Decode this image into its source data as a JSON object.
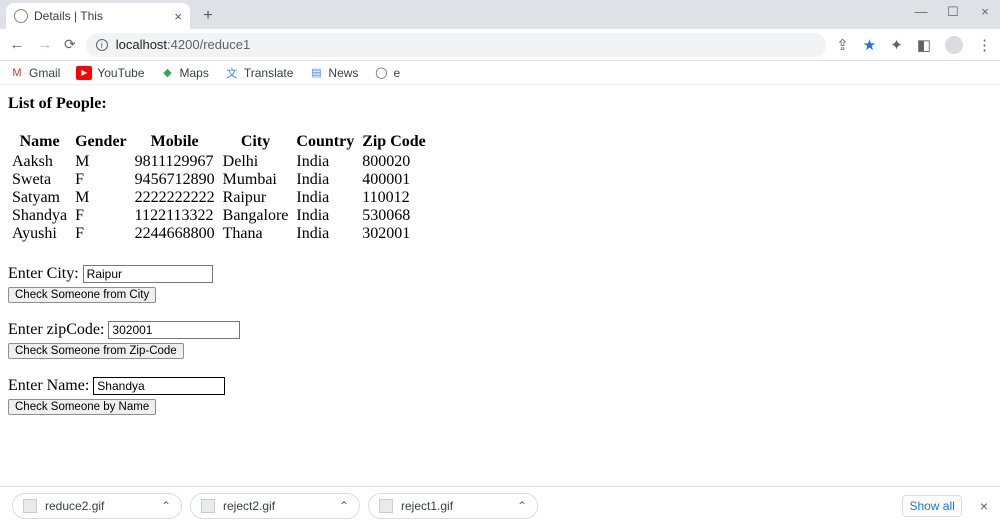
{
  "window": {
    "tab_title": "Details | This",
    "url_display": "localhost:4200/reduce1",
    "url_host": "localhost",
    "url_port_path": ":4200/reduce1"
  },
  "bookmarks": [
    {
      "label": "Gmail",
      "icon": "gmail"
    },
    {
      "label": "YouTube",
      "icon": "yt"
    },
    {
      "label": "Maps",
      "icon": "maps"
    },
    {
      "label": "Translate",
      "icon": "trans"
    },
    {
      "label": "News",
      "icon": "news"
    },
    {
      "label": "e",
      "icon": "globe"
    }
  ],
  "page": {
    "heading": "List of People:",
    "columns": [
      "Name",
      "Gender",
      "Mobile",
      "City",
      "Country",
      "Zip Code"
    ],
    "rows": [
      {
        "name": "Aaksh",
        "gender": "M",
        "mobile": "9811129967",
        "city": "Delhi",
        "country": "India",
        "zip": "800020"
      },
      {
        "name": "Sweta",
        "gender": "F",
        "mobile": "9456712890",
        "city": "Mumbai",
        "country": "India",
        "zip": "400001"
      },
      {
        "name": "Satyam",
        "gender": "M",
        "mobile": "2222222222",
        "city": "Raipur",
        "country": "India",
        "zip": "110012"
      },
      {
        "name": "Shandya",
        "gender": "F",
        "mobile": "1122113322",
        "city": "Bangalore",
        "country": "India",
        "zip": "530068"
      },
      {
        "name": "Ayushi",
        "gender": "F",
        "mobile": "2244668800",
        "city": "Thana",
        "country": "India",
        "zip": "302001"
      }
    ],
    "forms": {
      "city": {
        "label": "Enter City:",
        "value": "Raipur",
        "button": "Check Someone from City"
      },
      "zip": {
        "label": "Enter zipCode:",
        "value": "302001",
        "button": "Check Someone from Zip-Code"
      },
      "name": {
        "label": "Enter Name:",
        "value": "Shandya",
        "button": "Check Someone by Name"
      }
    }
  },
  "downloads": {
    "items": [
      "reduce2.gif",
      "reject2.gif",
      "reject1.gif"
    ],
    "show_all": "Show all"
  }
}
